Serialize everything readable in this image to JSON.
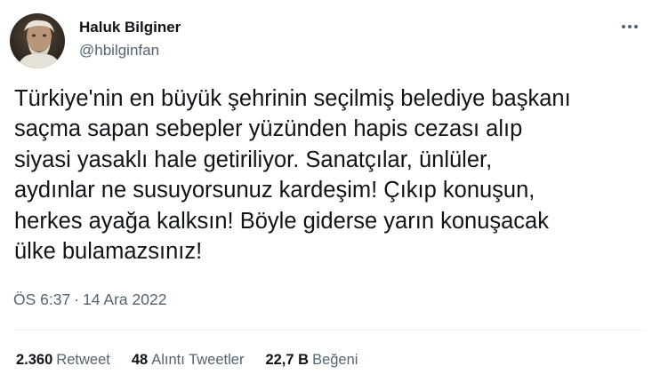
{
  "author": {
    "name": "Haluk Bilginer",
    "handle": "@hbilginfan",
    "avatar_icon": "profile-photo"
  },
  "more_icon": "more-horizontal-icon",
  "tweet": {
    "lines": [
      "Türkiye'nin en büyük şehrinin seçilmiş belediye başkanı",
      "saçma sapan sebepler yüzünden hapis cezası alıp",
      "siyasi yasaklı hale getiriliyor. Sanatçılar, ünlüler,",
      "aydınlar ne susuyorsunuz kardeşim! Çıkıp konuşun,",
      "herkes ayağa kalksın! Böyle giderse yarın konuşacak",
      "ülke bulamazsınız!"
    ],
    "time": "ÖS 6:37",
    "separator": "·",
    "date": "14 Ara 2022"
  },
  "stats": {
    "retweets": {
      "count": "2.360",
      "label": "Retweet"
    },
    "quotes": {
      "count": "48",
      "label": "Alıntı Tweetler"
    },
    "likes": {
      "count": "22,7 B",
      "label": "Beğeni"
    }
  },
  "colors": {
    "text": "#0f1419",
    "secondary": "#536471",
    "divider": "#eff3f4"
  }
}
